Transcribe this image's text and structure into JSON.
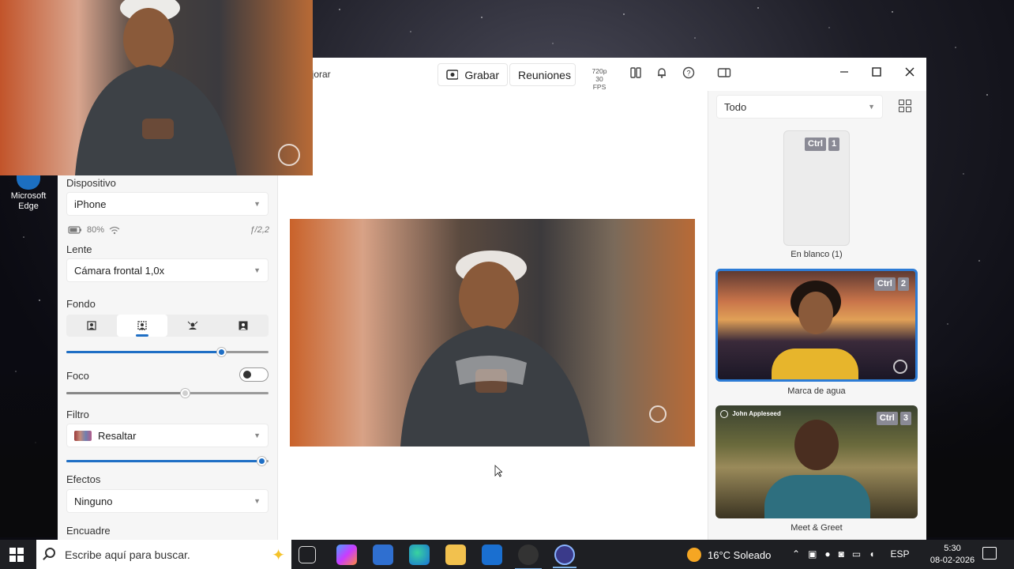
{
  "desktop": {
    "edge_label": "Microsoft Edge"
  },
  "titlebar": {
    "improve_label": "ejorar",
    "record_label": "Grabar",
    "meetings_label": "Reuniones",
    "resolution": "720p",
    "fps": "30 FPS"
  },
  "left_panel": {
    "device_label": "Dispositivo",
    "device_value": "iPhone",
    "battery": "80%",
    "aperture": "ƒ/2,2",
    "lens_label": "Lente",
    "lens_value": "Cámara frontal 1,0x",
    "background_label": "Fondo",
    "background_level": 0.77,
    "focus_label": "Foco",
    "focus_level": 0.59,
    "filter_label": "Filtro",
    "filter_value": "Resaltar",
    "filter_level": 0.97,
    "effects_label": "Efectos",
    "effects_value": "Ninguno",
    "framing_label": "Encuadre"
  },
  "right_panel": {
    "filter_value": "Todo",
    "cards": [
      {
        "title": "En blanco (1)",
        "key": "Ctrl",
        "num": "1"
      },
      {
        "title": "Marca de agua",
        "key": "Ctrl",
        "num": "2"
      },
      {
        "title": "Meet & Greet",
        "key": "Ctrl",
        "num": "3",
        "overlay_name": "John Appleseed"
      }
    ]
  },
  "taskbar": {
    "search_placeholder": "Escribe aquí para buscar.",
    "weather": "16°C Soleado",
    "lang": "ESP",
    "time": "5:30",
    "date": "08-02-2026"
  },
  "colors": {
    "accent": "#1f6fc5",
    "taskbar": "#1e1f23"
  }
}
